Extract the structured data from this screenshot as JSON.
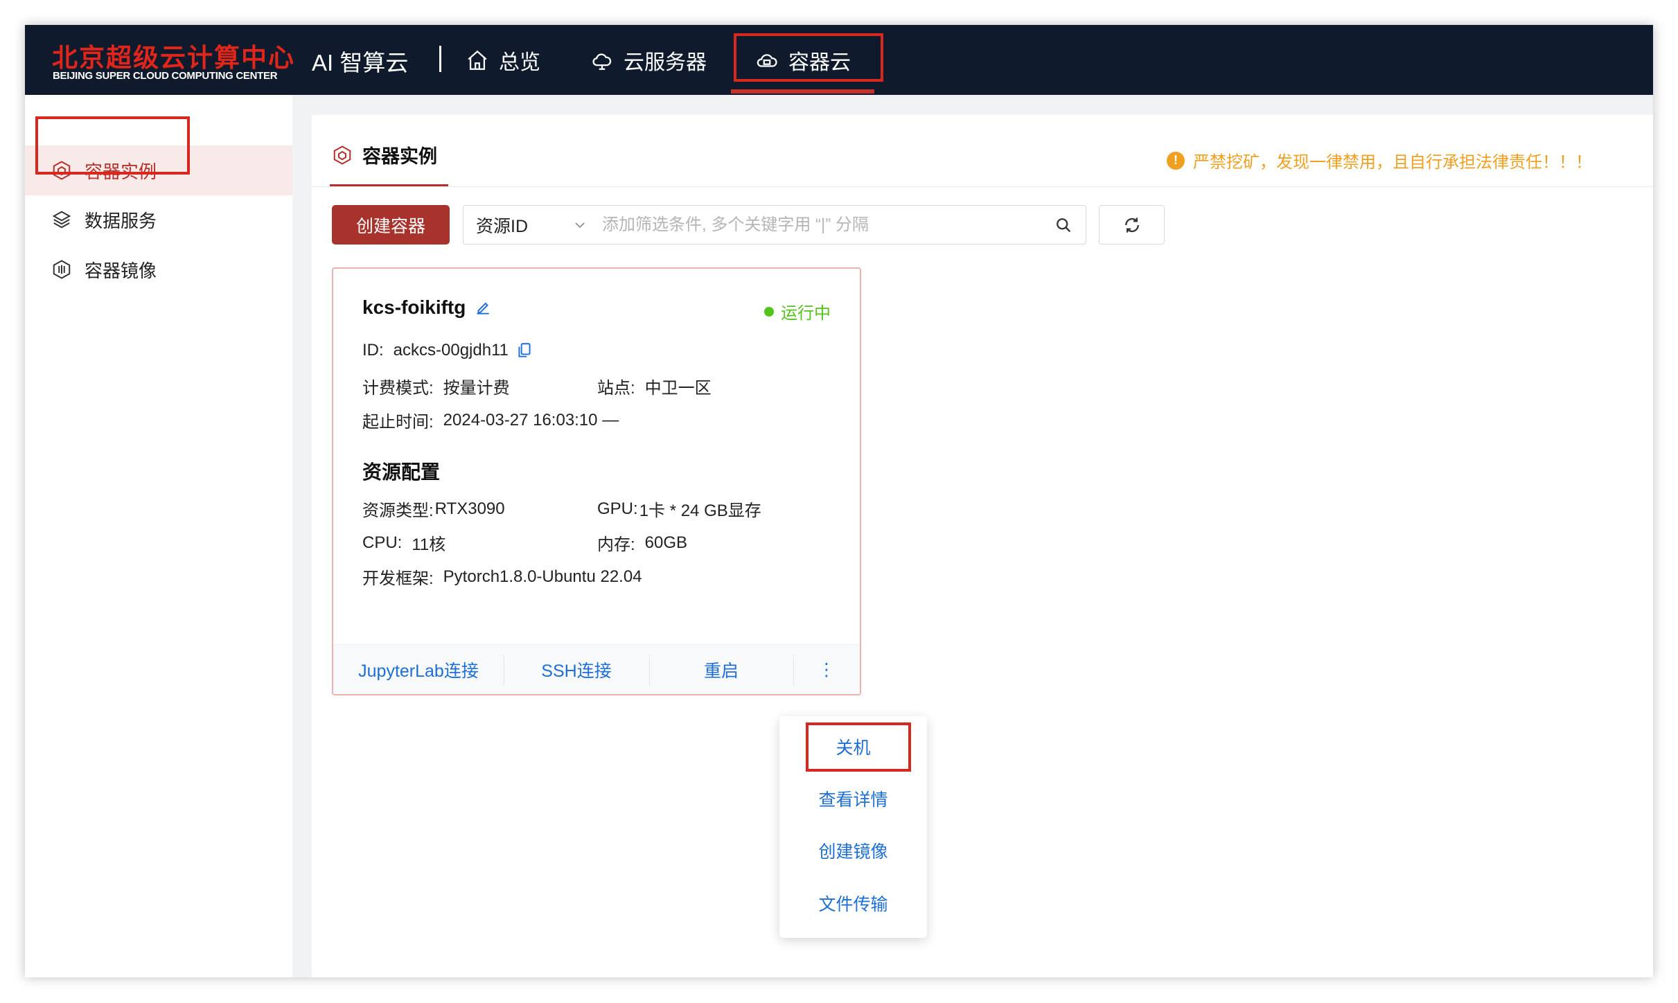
{
  "header": {
    "logo_cn": "北京超级云计算中心",
    "logo_en": "BEIJING SUPER CLOUD COMPUTING CENTER",
    "product": "AI 智算云",
    "nav": [
      {
        "label": "总览",
        "icon": "home-icon"
      },
      {
        "label": "云服务器",
        "icon": "cloud-server-icon"
      },
      {
        "label": "容器云",
        "icon": "container-cloud-icon",
        "active": true
      }
    ]
  },
  "sidebar": {
    "items": [
      {
        "label": "容器实例",
        "icon": "container-instance-icon",
        "active": true
      },
      {
        "label": "数据服务",
        "icon": "layers-icon"
      },
      {
        "label": "容器镜像",
        "icon": "image-icon"
      }
    ]
  },
  "main": {
    "tab": "容器实例",
    "warning": "严禁挖矿，发现一律禁用，且自行承担法律责任！！！",
    "create_button": "创建容器",
    "filter": {
      "select_value": "资源ID",
      "placeholder": "添加筛选条件, 多个关键字用 “|” 分隔"
    }
  },
  "instance": {
    "name": "kcs-foikiftg",
    "status": "运行中",
    "id_label": "ID:",
    "id_value": "ackcs-00gjdh11",
    "billing_label": "计费模式:",
    "billing_value": "按量计费",
    "site_label": "站点:",
    "site_value": "中卫一区",
    "time_label": "起止时间:",
    "time_value": "2024-03-27 16:03:10 —",
    "resources_title": "资源配置",
    "res_type_label": "资源类型:",
    "res_type_value": "RTX3090",
    "gpu_label": "GPU:",
    "gpu_value": "1卡 * 24 GB显存",
    "cpu_label": "CPU:",
    "cpu_value": "11核",
    "mem_label": "内存:",
    "mem_value": "60GB",
    "framework_label": "开发框架:",
    "framework_value": "Pytorch1.8.0-Ubuntu 22.04",
    "actions": [
      "JupyterLab连接",
      "SSH连接",
      "重启",
      "⋮"
    ]
  },
  "dropdown": {
    "items": [
      "关机",
      "查看详情",
      "创建镜像",
      "文件传输"
    ]
  },
  "colors": {
    "header_bg": "#0f1b2d",
    "brand_red": "#a8322c",
    "highlight_red": "#d6281f",
    "link_blue": "#1d6fd6",
    "status_green": "#52c41a",
    "warning_orange": "#f0a020"
  }
}
